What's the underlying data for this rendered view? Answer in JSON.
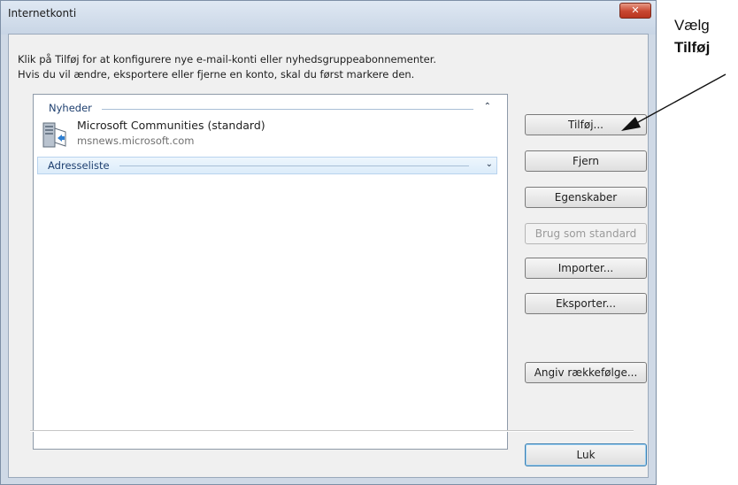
{
  "window": {
    "title": "Internetkonti",
    "close_glyph": "✕"
  },
  "instructions": {
    "line1": "Klik på Tilføj for at konfigurere nye e-mail-konti eller nyhedsgruppeabonnementer.",
    "line2": "Hvis du vil ændre, eksportere eller fjerne en konto, skal du først markere den."
  },
  "list": {
    "groups": [
      {
        "label": "Nyheder",
        "chevron": "⌃",
        "accounts": [
          {
            "name": "Microsoft Communities (standard)",
            "server": "msnews.microsoft.com",
            "icon": "news-server-icon"
          }
        ]
      },
      {
        "label": "Adresseliste",
        "chevron": "⌄"
      }
    ]
  },
  "buttons": {
    "add": "Tilføj...",
    "remove": "Fjern",
    "properties": "Egenskaber",
    "set_default": "Brug som standard",
    "import": "Importer...",
    "export": "Eksporter...",
    "set_order": "Angiv rækkefølge...",
    "close": "Luk"
  },
  "annotation": {
    "line1": "Vælg",
    "line2": "Tilføj"
  },
  "colors": {
    "close_button": "#c8462f",
    "group_header_text": "#1e3f6f",
    "luk_focus_border": "#3c7fb1"
  }
}
